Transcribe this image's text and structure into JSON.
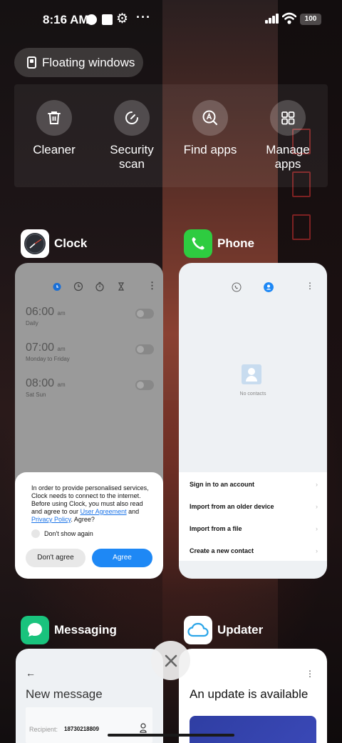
{
  "status_bar": {
    "time": "8:16 AM",
    "battery": "100"
  },
  "floating_windows": {
    "label": "Floating windows"
  },
  "quick_actions": [
    {
      "label": "Cleaner",
      "icon": "trash-icon"
    },
    {
      "label": "Security scan",
      "icon": "security-gauge-icon"
    },
    {
      "label": "Find apps",
      "icon": "find-apps-icon"
    },
    {
      "label": "Manage apps",
      "icon": "grid-icon"
    }
  ],
  "apps": {
    "clock": {
      "name": "Clock",
      "alarms": [
        {
          "time": "06:00",
          "ampm": "am",
          "repeat": "Daily"
        },
        {
          "time": "07:00",
          "ampm": "am",
          "repeat": "Monday to Friday"
        },
        {
          "time": "08:00",
          "ampm": "am",
          "repeat": "Sat Sun"
        }
      ],
      "consent": {
        "text_before": "In order to provide personalised services, Clock needs to connect to the internet. Before using Clock, you must also read and agree to our ",
        "link_agreement": "User Agreement",
        "text_and": " and ",
        "link_privacy": "Privacy Policy",
        "text_after": ". Agree?",
        "checkbox_label": "Don't show again",
        "disagree_label": "Don't agree",
        "agree_label": "Agree"
      }
    },
    "phone": {
      "name": "Phone",
      "empty_label": "No contacts",
      "options": [
        "Sign in to an account",
        "Import from an older device",
        "Import from a file",
        "Create a new contact"
      ]
    },
    "messaging": {
      "name": "Messaging",
      "title": "New message",
      "recipient_label": "Recipient:",
      "recipient_value": "18730218809"
    },
    "updater": {
      "name": "Updater",
      "title": "An update is available"
    }
  },
  "colors": {
    "accent_blue": "#1e88f5",
    "phone_green": "#2ecc40",
    "messaging_green": "#19c37d"
  }
}
